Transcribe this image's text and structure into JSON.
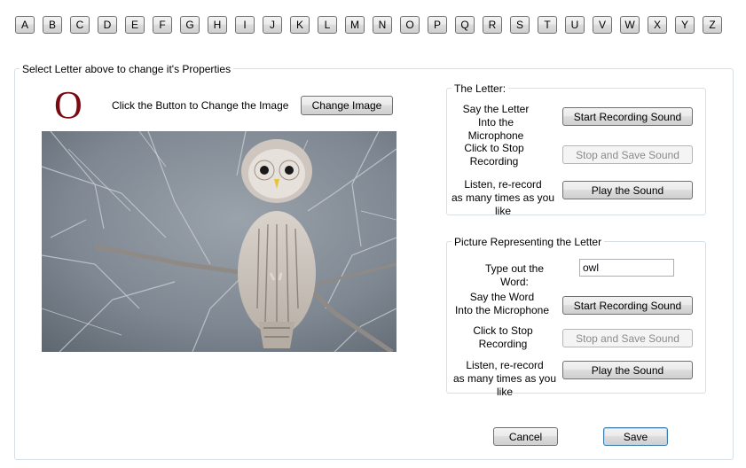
{
  "letters": [
    "A",
    "B",
    "C",
    "D",
    "E",
    "F",
    "G",
    "H",
    "I",
    "J",
    "K",
    "L",
    "M",
    "N",
    "O",
    "P",
    "Q",
    "R",
    "S",
    "T",
    "U",
    "V",
    "W",
    "X",
    "Y",
    "Z"
  ],
  "properties_group": {
    "title": "Select Letter above to change it's Properties",
    "selected_letter": "O",
    "change_image_hint": "Click the Button to Change the Image",
    "change_image_label": "Change Image"
  },
  "letter_group": {
    "title": "The Letter:",
    "say_label_line1": "Say the Letter",
    "say_label_line2": "Into the Microphone",
    "start_recording_label": "Start Recording Sound",
    "stop_label_line1": "Click to Stop",
    "stop_label_line2": "Recording",
    "stop_save_label": "Stop and Save Sound",
    "listen_line1": "Listen, re-record",
    "listen_line2": "as many times as you like",
    "play_label": "Play the Sound"
  },
  "picture_group": {
    "title": "Picture Representing the Letter",
    "type_word_label": "Type out the Word:",
    "word_value": "owl",
    "say_label_line1": "Say the Word",
    "say_label_line2": "Into the Microphone",
    "start_recording_label": "Start Recording Sound",
    "stop_label_line1": "Click to Stop",
    "stop_label_line2": "Recording",
    "stop_save_label": "Stop and Save Sound",
    "listen_line1": "Listen, re-record",
    "listen_line2": "as many times as you like",
    "play_label": "Play the Sound"
  },
  "footer": {
    "cancel_label": "Cancel",
    "save_label": "Save"
  }
}
